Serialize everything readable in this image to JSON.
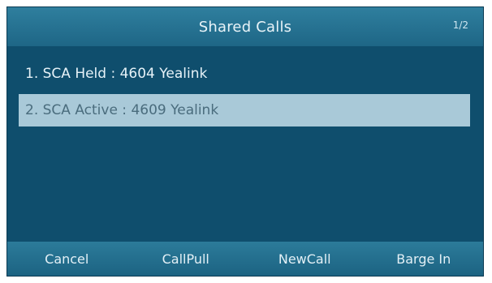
{
  "header": {
    "title": "Shared Calls",
    "counter": "1/2"
  },
  "calls": [
    {
      "label": "1. SCA Held : 4604 Yealink"
    },
    {
      "label": "2. SCA Active : 4609 Yealink"
    }
  ],
  "softkeys": [
    {
      "label": "Cancel"
    },
    {
      "label": "CallPull"
    },
    {
      "label": "NewCall"
    },
    {
      "label": "Barge In"
    }
  ],
  "colors": {
    "background": "#0f4e6d",
    "title_bar": "#2f7f9e",
    "selected_row": "#a9c9d8",
    "text": "#e6f2f8"
  }
}
